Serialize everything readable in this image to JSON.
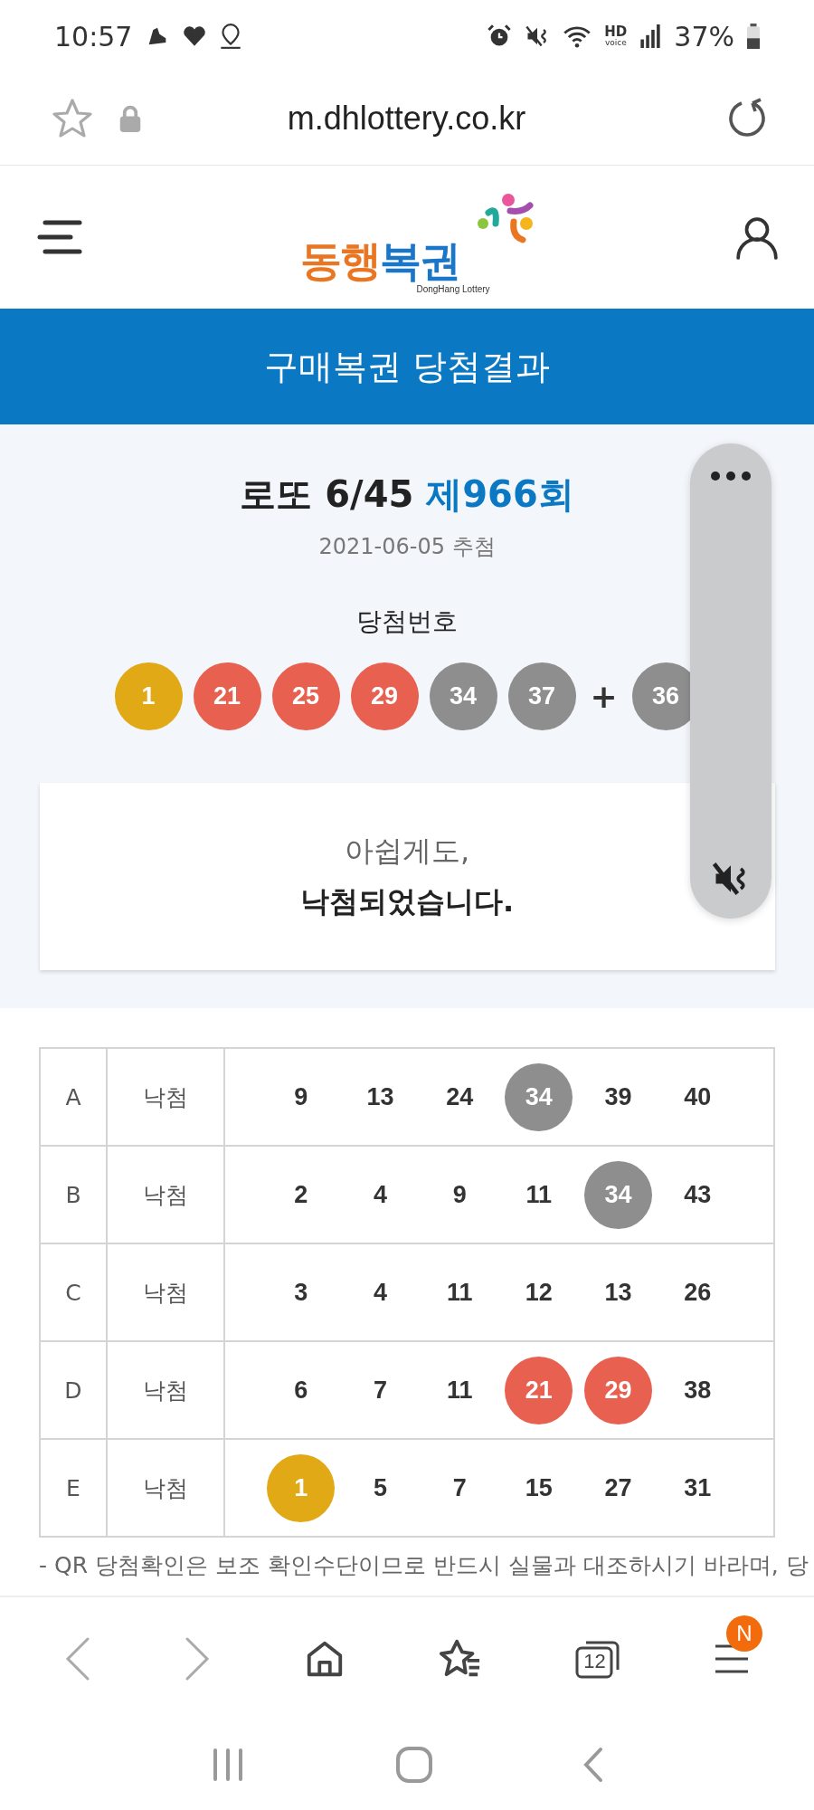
{
  "status_bar": {
    "time": "10:57",
    "hd": "HD",
    "hd_sub": "voice",
    "battery": "37%"
  },
  "url_bar": {
    "url": "m.dhlottery.co.kr"
  },
  "header": {
    "logo_part_1": "동행",
    "logo_part_2": "복권",
    "logo_subtext": "DongHang Lottery"
  },
  "banner": {
    "title": "구매복권 당첨결과"
  },
  "draw": {
    "game": "로또 6/45",
    "round": "제966회",
    "date": "2021-06-05 추첨",
    "numbers_label": "당첨번호",
    "plus": "+",
    "numbers": [
      {
        "value": "1",
        "color": "#e2a916"
      },
      {
        "value": "21",
        "color": "#e8604f"
      },
      {
        "value": "25",
        "color": "#e8604f"
      },
      {
        "value": "29",
        "color": "#e8604f"
      },
      {
        "value": "34",
        "color": "#8e8e8e"
      },
      {
        "value": "37",
        "color": "#8e8e8e"
      }
    ],
    "bonus": {
      "value": "36",
      "color": "#8e8e8e"
    }
  },
  "result": {
    "line_1": "아쉽게도,",
    "line_2": "낙첨되었습니다."
  },
  "tickets": [
    {
      "label": "A",
      "result": "낙첨",
      "numbers": [
        {
          "value": "9",
          "matched": false
        },
        {
          "value": "13",
          "matched": false
        },
        {
          "value": "24",
          "matched": false
        },
        {
          "value": "34",
          "matched": true,
          "color": "#8e8e8e"
        },
        {
          "value": "39",
          "matched": false
        },
        {
          "value": "40",
          "matched": false
        }
      ]
    },
    {
      "label": "B",
      "result": "낙첨",
      "numbers": [
        {
          "value": "2",
          "matched": false
        },
        {
          "value": "4",
          "matched": false
        },
        {
          "value": "9",
          "matched": false
        },
        {
          "value": "11",
          "matched": false
        },
        {
          "value": "34",
          "matched": true,
          "color": "#8e8e8e"
        },
        {
          "value": "43",
          "matched": false
        }
      ]
    },
    {
      "label": "C",
      "result": "낙첨",
      "numbers": [
        {
          "value": "3",
          "matched": false
        },
        {
          "value": "4",
          "matched": false
        },
        {
          "value": "11",
          "matched": false
        },
        {
          "value": "12",
          "matched": false
        },
        {
          "value": "13",
          "matched": false
        },
        {
          "value": "26",
          "matched": false
        }
      ]
    },
    {
      "label": "D",
      "result": "낙첨",
      "numbers": [
        {
          "value": "6",
          "matched": false
        },
        {
          "value": "7",
          "matched": false
        },
        {
          "value": "11",
          "matched": false
        },
        {
          "value": "21",
          "matched": true,
          "color": "#e8604f"
        },
        {
          "value": "29",
          "matched": true,
          "color": "#e8604f"
        },
        {
          "value": "38",
          "matched": false
        }
      ]
    },
    {
      "label": "E",
      "result": "낙첨",
      "numbers": [
        {
          "value": "1",
          "matched": true,
          "color": "#e2a916"
        },
        {
          "value": "5",
          "matched": false
        },
        {
          "value": "7",
          "matched": false
        },
        {
          "value": "15",
          "matched": false
        },
        {
          "value": "27",
          "matched": false
        },
        {
          "value": "31",
          "matched": false
        }
      ]
    }
  ],
  "notice": "- QR 당첨확인은 보조 확인수단이므로 반드시 실물과 대조하시기 바라며, 당",
  "browser_nav": {
    "tab_count": "12",
    "badge": "N"
  }
}
